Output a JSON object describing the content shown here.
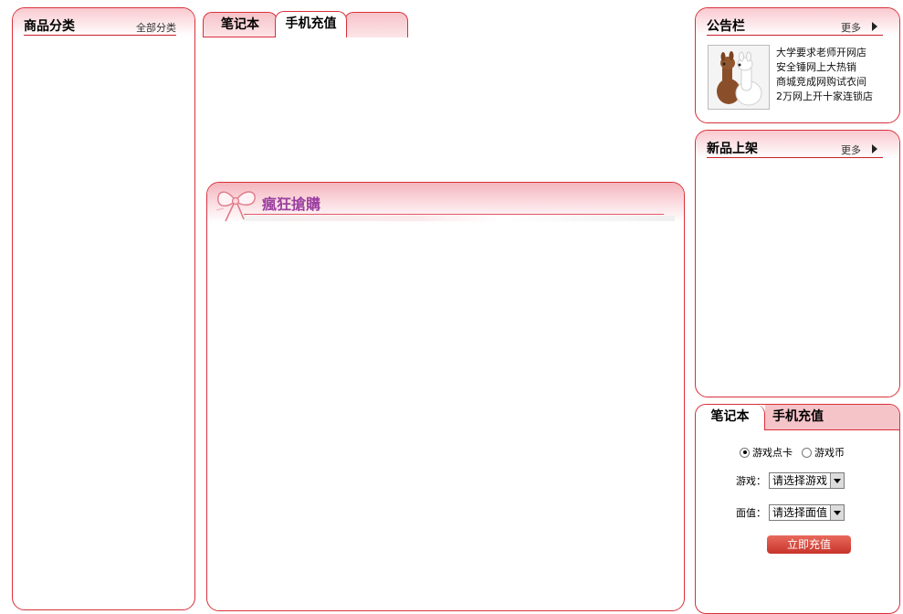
{
  "category_panel": {
    "title": "商品分类",
    "all_link": "全部分类"
  },
  "center_tabs": [
    {
      "label": "笔记本"
    },
    {
      "label": "手机充值"
    }
  ],
  "promo": {
    "title": "瘋狂搶購"
  },
  "notice_panel": {
    "title": "公告栏",
    "more": "更多",
    "items": [
      "大学要求老师开网店",
      "安全锤网上大热销",
      "商城竞成网购试衣间",
      "2万网上开十家连锁店"
    ]
  },
  "new_panel": {
    "title": "新品上架",
    "more": "更多"
  },
  "recharge": {
    "tabs": [
      {
        "label": "笔记本"
      },
      {
        "label": "手机充值"
      }
    ],
    "radio_game_card": "游戏点卡",
    "radio_game_coin": "游戏币",
    "game_label": "游戏：",
    "game_select": "请选择游戏",
    "value_label": "面值：",
    "value_select": "请选择面值",
    "submit": "立即充值"
  },
  "colors": {
    "border": "#d9303a",
    "tab_pink": "#f5c4c9",
    "promo_title": "#9b3fa0"
  }
}
